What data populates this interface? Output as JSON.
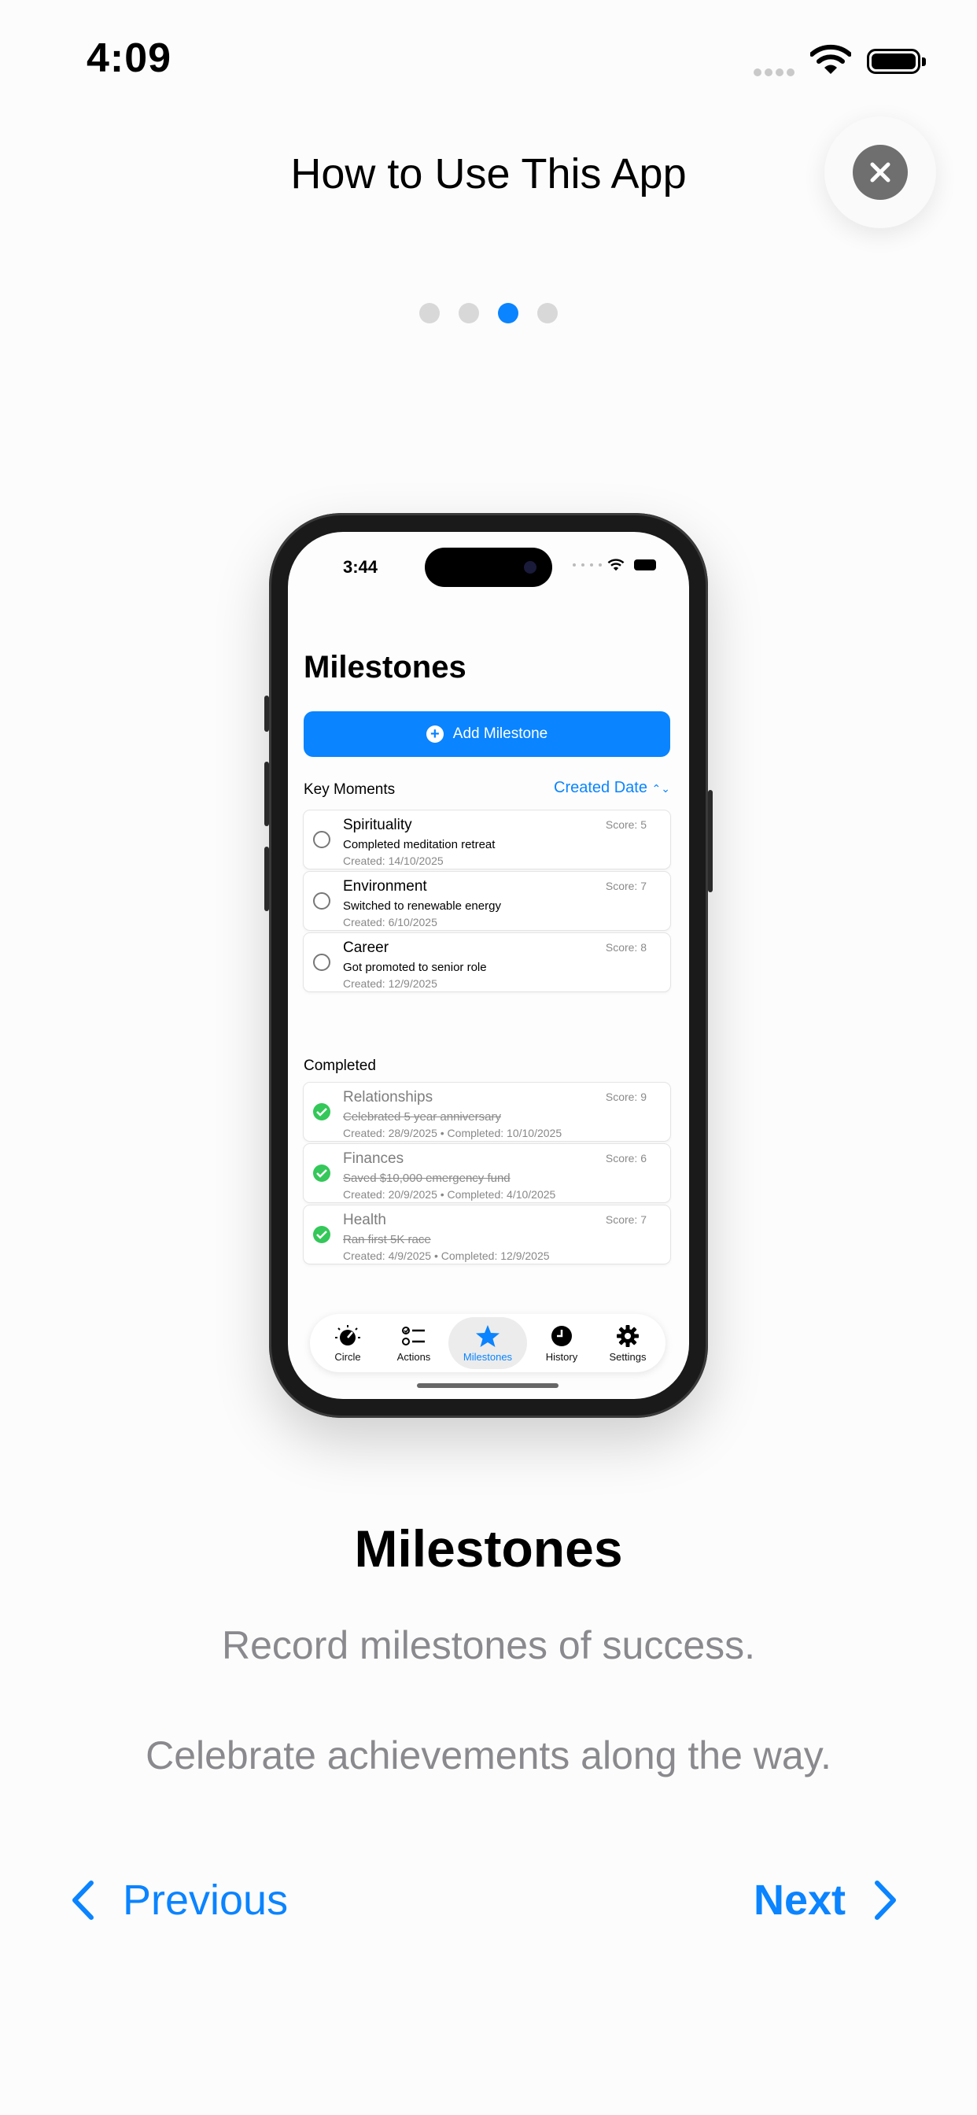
{
  "status_bar": {
    "time": "4:09"
  },
  "header": {
    "title": "How to Use This App"
  },
  "pager": {
    "count": 4,
    "active_index": 2
  },
  "mockup": {
    "status_time": "3:44",
    "title": "Milestones",
    "add_button_label": "Add Milestone",
    "key_moments_label": "Key Moments",
    "sort_label": "Created Date",
    "key_moments": [
      {
        "name": "Spirituality",
        "desc": "Completed meditation retreat",
        "meta": "Created: 14/10/2025",
        "score": "Score: 5"
      },
      {
        "name": "Environment",
        "desc": "Switched to renewable energy",
        "meta": "Created: 6/10/2025",
        "score": "Score: 7"
      },
      {
        "name": "Career",
        "desc": "Got promoted to senior role",
        "meta": "Created: 12/9/2025",
        "score": "Score: 8"
      }
    ],
    "completed_label": "Completed",
    "completed": [
      {
        "name": "Relationships",
        "desc": "Celebrated 5 year anniversary",
        "meta": "Created: 28/9/2025 • Completed: 10/10/2025",
        "score": "Score: 9"
      },
      {
        "name": "Finances",
        "desc": "Saved $10,000 emergency fund",
        "meta": "Created: 20/9/2025 • Completed: 4/10/2025",
        "score": "Score: 6"
      },
      {
        "name": "Health",
        "desc": "Ran first 5K race",
        "meta": "Created: 4/9/2025 • Completed: 12/9/2025",
        "score": "Score: 7"
      }
    ],
    "tabs": [
      {
        "label": "Circle",
        "icon": "gauge-icon"
      },
      {
        "label": "Actions",
        "icon": "checklist-icon"
      },
      {
        "label": "Milestones",
        "icon": "star-icon",
        "active": true
      },
      {
        "label": "History",
        "icon": "clock-icon"
      },
      {
        "label": "Settings",
        "icon": "gear-icon"
      }
    ]
  },
  "content": {
    "heading": "Milestones",
    "line1": "Record milestones of success.",
    "line2": "Celebrate achievements along the way."
  },
  "nav": {
    "previous_label": "Previous",
    "next_label": "Next"
  },
  "colors": {
    "accent": "#0a84ff",
    "success": "#34c759",
    "secondary_text": "#8a8a8e"
  }
}
